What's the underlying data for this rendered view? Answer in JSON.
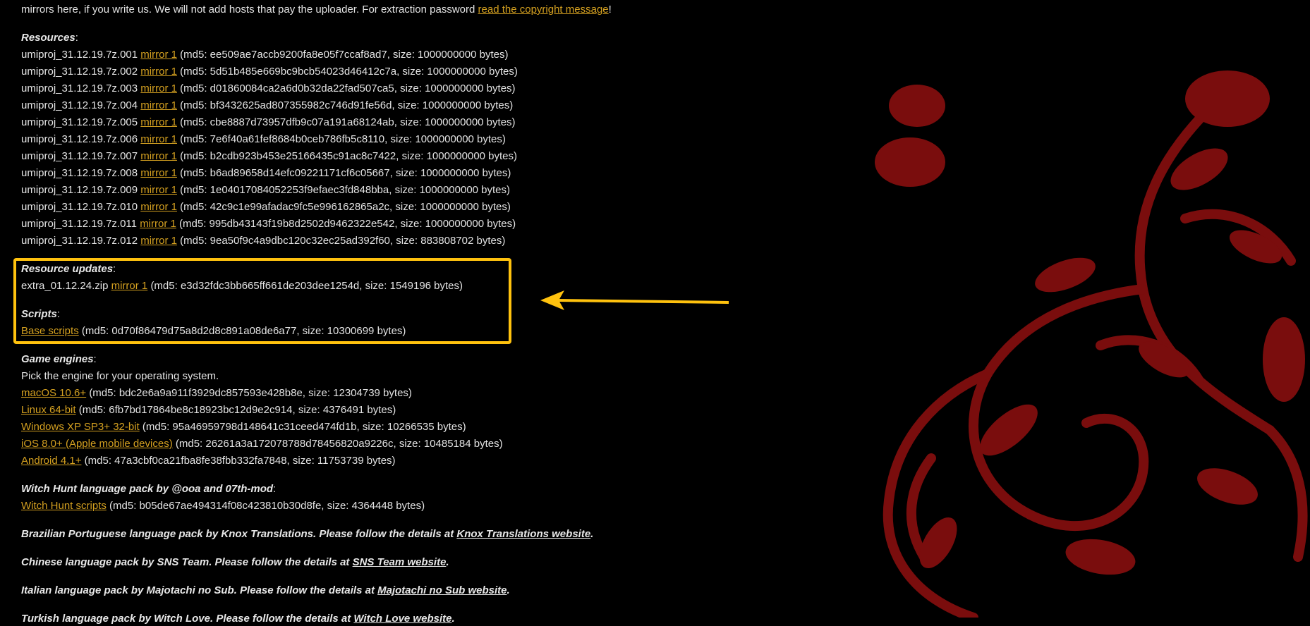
{
  "intro": {
    "text": "mirrors here, if you write us. We will not add hosts that pay the uploader. For extraction password ",
    "link": "read the copyright message",
    "end": "!"
  },
  "resources": {
    "heading": "Resources",
    "items": [
      {
        "file": "umiproj_31.12.19.7z.001",
        "link": "mirror 1",
        "meta": "(md5: ee509ae7accb9200fa8e05f7ccaf8ad7, size: 1000000000 bytes)"
      },
      {
        "file": "umiproj_31.12.19.7z.002",
        "link": "mirror 1",
        "meta": "(md5: 5d51b485e669bc9bcb54023d46412c7a, size: 1000000000 bytes)"
      },
      {
        "file": "umiproj_31.12.19.7z.003",
        "link": "mirror 1",
        "meta": "(md5: d01860084ca2a6d0b32da22fad507ca5, size: 1000000000 bytes)"
      },
      {
        "file": "umiproj_31.12.19.7z.004",
        "link": "mirror 1",
        "meta": "(md5: bf3432625ad807355982c746d91fe56d, size: 1000000000 bytes)"
      },
      {
        "file": "umiproj_31.12.19.7z.005",
        "link": "mirror 1",
        "meta": "(md5: cbe8887d73957dfb9c07a191a68124ab, size: 1000000000 bytes)"
      },
      {
        "file": "umiproj_31.12.19.7z.006",
        "link": "mirror 1",
        "meta": "(md5: 7e6f40a61fef8684b0ceb786fb5c8110, size: 1000000000 bytes)"
      },
      {
        "file": "umiproj_31.12.19.7z.007",
        "link": "mirror 1",
        "meta": "(md5: b2cdb923b453e25166435c91ac8c7422, size: 1000000000 bytes)"
      },
      {
        "file": "umiproj_31.12.19.7z.008",
        "link": "mirror 1",
        "meta": "(md5: b6ad89658d14efc09221171cf6c05667, size: 1000000000 bytes)"
      },
      {
        "file": "umiproj_31.12.19.7z.009",
        "link": "mirror 1",
        "meta": "(md5: 1e04017084052253f9efaec3fd848bba, size: 1000000000 bytes)"
      },
      {
        "file": "umiproj_31.12.19.7z.010",
        "link": "mirror 1",
        "meta": "(md5: 42c9c1e99afadac9fc5e996162865a2c, size: 1000000000 bytes)"
      },
      {
        "file": "umiproj_31.12.19.7z.011",
        "link": "mirror 1",
        "meta": "(md5: 995db43143f19b8d2502d9462322e542, size: 1000000000 bytes)"
      },
      {
        "file": "umiproj_31.12.19.7z.012",
        "link": "mirror 1",
        "meta": "(md5: 9ea50f9c4a9dbc120c32ec25ad392f60, size: 883808702 bytes)"
      }
    ]
  },
  "updates": {
    "heading": "Resource updates",
    "file": "extra_01.12.24.zip",
    "link": "mirror 1",
    "meta": "(md5: e3d32fdc3bb665ff661de203dee1254d, size: 1549196 bytes)"
  },
  "scripts": {
    "heading": "Scripts",
    "link": "Base scripts",
    "meta": "(md5: 0d70f86479d75a8d2d8c891a08de6a77, size: 10300699 bytes)"
  },
  "engines": {
    "heading": "Game engines",
    "desc": "Pick the engine for your operating system.",
    "items": [
      {
        "link": "macOS 10.6+",
        "meta": "(md5: bdc2e6a9a911f3929dc857593e428b8e, size: 12304739 bytes)"
      },
      {
        "link": "Linux 64-bit",
        "meta": "(md5: 6fb7bd17864be8c18923bc12d9e2c914, size: 4376491 bytes)"
      },
      {
        "link": "Windows XP SP3+ 32-bit",
        "meta": "(md5: 95a46959798d148641c31ceed474fd1b, size: 10266535 bytes)"
      },
      {
        "link": "iOS 8.0+ (Apple mobile devices)",
        "meta": "(md5: 26261a3a172078788d78456820a9226c, size: 10485184 bytes)"
      },
      {
        "link": "Android 4.1+",
        "meta": "(md5: 47a3cbf0ca21fba8fe38fbb332fa7848, size: 11753739 bytes)"
      }
    ]
  },
  "witch": {
    "heading": "Witch Hunt language pack by @ooa and 07th-mod",
    "link": "Witch Hunt scripts",
    "meta": "(md5: b05de67ae494314f08c423810b30d8fe, size: 4364448 bytes)"
  },
  "langpacks": [
    {
      "text": "Brazilian Portuguese language pack by Knox Translations. Please follow the details at ",
      "link": "Knox Translations website"
    },
    {
      "text": "Chinese language pack by SNS Team. Please follow the details at ",
      "link": "SNS Team website"
    },
    {
      "text": "Italian language pack by Majotachi no Sub. Please follow the details at ",
      "link": "Majotachi no Sub website"
    },
    {
      "text": "Turkish language pack by Witch Love. Please follow the details at ",
      "link": "Witch Love website"
    }
  ],
  "colors": {
    "link": "#d4a020",
    "highlight": "#ffc20e",
    "decoration": "#7a0d0d"
  }
}
